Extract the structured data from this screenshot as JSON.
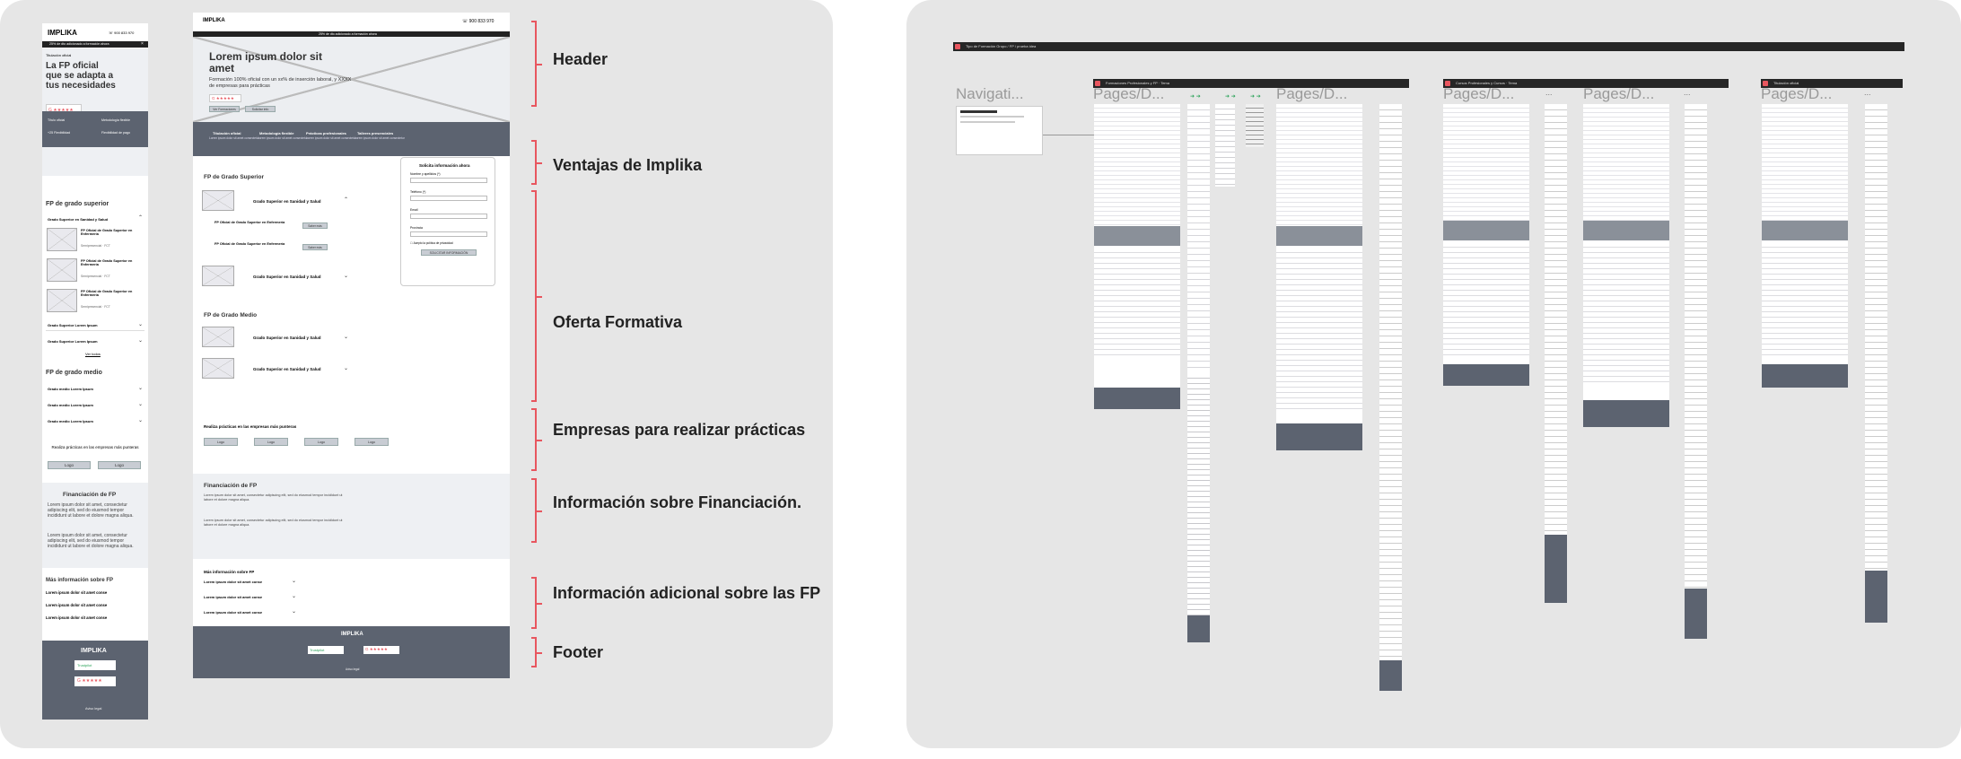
{
  "mobile": {
    "logo": "IMPLIKA",
    "phone": "900 833 970",
    "promo": "25% de dto adicionado a formación ahora",
    "hero_tag": "Titulación oficial",
    "hero_title": "La FP oficial que se adapta a tus necesidades",
    "btn1": "Verificar ahora",
    "btn2": "Verificar ahora",
    "features": [
      "Título oficial",
      "Metodología flexible",
      "+25 Flexibilidad",
      "Flexibilidad de pago"
    ],
    "sec1_title": "FP de grado superior",
    "acc1": "Grado Superior en Sanidad y Salud",
    "courses": [
      {
        "title": "FP Oficial de Grado Superior en Enfermería",
        "meta": "Semipresencial · FCT"
      },
      {
        "title": "FP Oficial de Grado Superior en Enfermería",
        "meta": "Semipresencial · FCT"
      },
      {
        "title": "FP Oficial de Grado Superior en Enfermería",
        "meta": "Semipresencial · FCT"
      }
    ],
    "acc2": "Grado Superior Lorem Ipsum",
    "acc3": "Grado Superior Lorem Ipsum",
    "ver_todos": "Ver todos",
    "sec2_title": "FP de grado medio",
    "gm_items": [
      "Grado medio Lorem Ipsum",
      "Grado medio Lorem Ipsum",
      "Grado medio Lorem Ipsum"
    ],
    "empresas": "Realiza prácticas en las empresas más punteras",
    "logo_label": "Logo",
    "fin_title": "Financiación de FP",
    "fin_p1": "Lorem ipsum dolor sit amet, consectetur adipiscing elit, sed do eiusmod tempor incididunt ut labore et dolore magna aliqua.",
    "fin_p2": "Lorem ipsum dolor sit amet, consectetur adipiscing elit, sed do eiusmod tempor incididunt ut labore et dolore magna aliqua.",
    "mas_title": "Más información sobre FP",
    "mas_items": [
      "Lorem ipsum dolor sit amet conse",
      "Lorem ipsum dolor sit amet conse",
      "Lorem ipsum dolor sit amet conse"
    ],
    "footer_logo": "IMPLIKA",
    "trustpilot": "Trustpilot",
    "footer_legal": "Aviso legal"
  },
  "desktop": {
    "logo": "IMPLIKA",
    "phone": "900 833 970",
    "promo": "25% de dto adicionado a formación ahora",
    "hero_title": "Lorem ipsum dolor sit amet",
    "hero_sub": "Formación 100% oficial con un xx% de inserción laboral, y XXXX de empresas para prácticas",
    "btn1": "Ver Formaciones",
    "btn2": "Solicitar info",
    "ventajas": [
      {
        "title": "Titulación oficial",
        "desc": "Lorem ipsum dolor sit amet consectetur"
      },
      {
        "title": "Metodología flexible",
        "desc": "Lorem ipsum dolor sit amet consectetur"
      },
      {
        "title": "Prácticas profesionales",
        "desc": "Lorem ipsum dolor sit amet consectetur"
      },
      {
        "title": "Talleres presenciales",
        "desc": "Lorem ipsum dolor sit amet consectetur"
      }
    ],
    "form_title": "Solicita información ahora",
    "form_name": "Nombre y apellidos (*)",
    "form_phone": "Teléfono (*)",
    "form_email": "Email",
    "form_prov": "Provincia",
    "form_check": "Acepto la política de privacidad",
    "form_btn": "SOLICITAR INFORMACIÓN",
    "gs_title": "FP de Grado Superior",
    "gs_acc": "Grado Superior en Sanidad y Salud",
    "gs_course": "FP Oficial de Grado Superior en Enfermería",
    "ver_mas": "Saber más",
    "gm_title": "FP de Grado Medio",
    "empresas": "Realiza prácticas en las empresas más punteras",
    "logo_label": "Logo",
    "fin_title": "Financiación de FP",
    "fin_p": "Lorem ipsum dolor sit amet, consectetur adipiscing elit, sed do eiusmod tempor incididunt ut labore et dolore magna aliqua.",
    "mas_title": "Más información sobre FP",
    "mas_items": [
      "Lorem ipsum dolor sit amet conse",
      "Lorem ipsum dolor sit amet conse",
      "Lorem ipsum dolor sit amet conse"
    ],
    "footer_logo": "IMPLIKA",
    "footer_legal": "Aviso legal"
  },
  "labels": {
    "header": "Header",
    "ventajas": "Ventajas de Implika",
    "oferta": "Oferta Formativa",
    "empresas": "Empresas para realizar prácticas",
    "financiacion": "Información sobre Financiación.",
    "adicional": "Información adicional sobre las FP",
    "footer": "Footer"
  },
  "canvas": {
    "top_bar": "Tipo de Formación Grupo / FP / prueba idea",
    "nav_title": "Navigati...",
    "sections": [
      {
        "bar": "Formaciones Profesionales y FP · Tema",
        "titles": [
          "Pages/D...",
          "Pages/D..."
        ]
      },
      {
        "bar": "Cursos Profesionales y Cursos · Tema",
        "titles": [
          "Pages/D...",
          "Pages/D..."
        ]
      },
      {
        "bar": "Titulación oficial",
        "titles": [
          "Pages/D..."
        ]
      }
    ],
    "ellipsis": "..."
  },
  "colors": {
    "accent": "#e8565f",
    "footer_gray": "#5c6370",
    "panel": "#e6e6e6"
  }
}
